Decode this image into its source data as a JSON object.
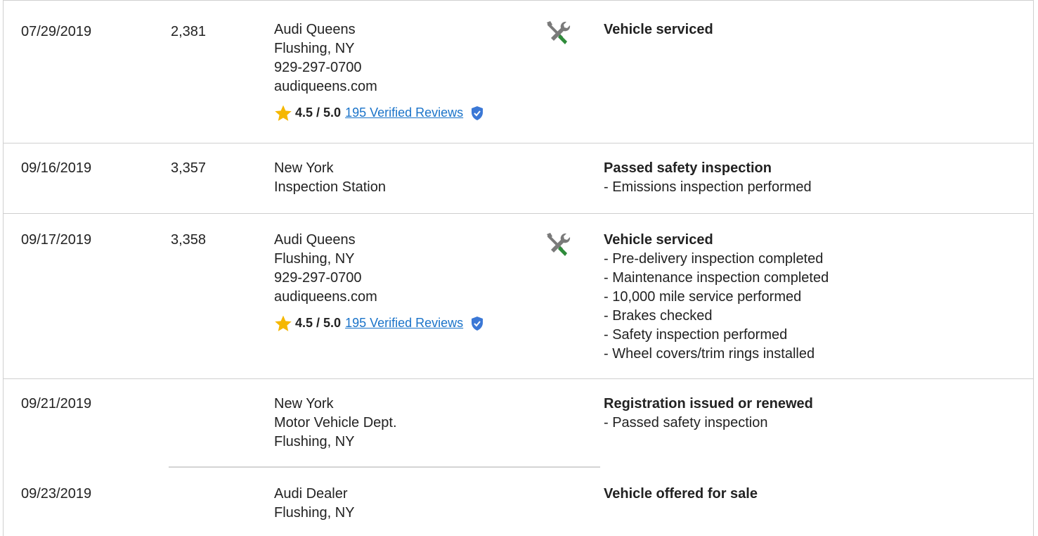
{
  "rows": [
    {
      "date": "07/29/2019",
      "mileage": "2,381",
      "source": [
        "Audi Queens",
        "Flushing, NY",
        "929-297-0700",
        "audiqueens.com"
      ],
      "rating": {
        "score": "4.5 / 5.0",
        "reviews": "195 Verified Reviews"
      },
      "icon": "service-wrench-icon",
      "title": "Vehicle serviced",
      "details": []
    },
    {
      "date": "09/16/2019",
      "mileage": "3,357",
      "source": [
        "New York",
        "Inspection Station"
      ],
      "title": "Passed safety inspection",
      "details": [
        "- Emissions inspection performed"
      ]
    },
    {
      "date": "09/17/2019",
      "mileage": "3,358",
      "source": [
        "Audi Queens",
        "Flushing, NY",
        "929-297-0700",
        "audiqueens.com"
      ],
      "rating": {
        "score": "4.5 / 5.0",
        "reviews": "195 Verified Reviews"
      },
      "icon": "service-wrench-icon",
      "title": "Vehicle serviced",
      "details": [
        "- Pre-delivery inspection completed",
        "- Maintenance inspection completed",
        "- 10,000 mile service performed",
        "- Brakes checked",
        "- Safety inspection performed",
        "- Wheel covers/trim rings installed"
      ]
    },
    {
      "date": "09/21/2019",
      "mileage": "",
      "source": [
        "New York",
        "Motor Vehicle Dept.",
        "Flushing, NY"
      ],
      "title": "Registration issued or renewed",
      "details": [
        "- Passed safety inspection"
      ]
    },
    {
      "date": "09/23/2019",
      "mileage": "",
      "source": [
        "Audi Dealer",
        "Flushing, NY"
      ],
      "title": "Vehicle offered for sale",
      "details": []
    }
  ],
  "colors": {
    "accent_link": "#1a73c9",
    "star": "#f5b700",
    "wrench_green": "#2e8b3a",
    "shield_blue": "#3b78d6"
  }
}
